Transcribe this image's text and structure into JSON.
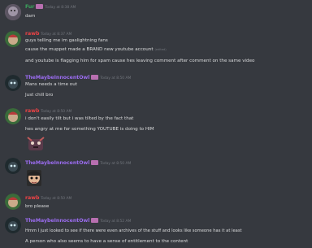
{
  "colors": {
    "background": "#36393f",
    "text": "#dcddde",
    "timestamp": "#72767d",
    "user_fur": "#3ba55d",
    "user_rawb": "#ed4245",
    "user_owl": "#9b6cf0",
    "badge": "#b86fb0"
  },
  "messages": [
    {
      "user": "Fur",
      "timestamp": "Today at 8:38 AM",
      "lines": [
        "dam"
      ]
    },
    {
      "user": "rawb",
      "timestamp": "Today at 8:37 AM",
      "lines": [
        "guys telling me im gaslightning fans",
        "cause the muppet made a BRAND new youtube account",
        "and youtube is flagging him for spam cause hes leaving comment after comment on the same video"
      ],
      "edited_label": "(edited)"
    },
    {
      "user": "TheMaybeInnocentOwl",
      "timestamp": "Today at 8:50 AM",
      "lines": [
        "Mans needs a time out",
        "Just chill bro"
      ]
    },
    {
      "user": "rawb",
      "timestamp": "Today at 8:50 AM",
      "lines": [
        "i don't easily tilt but i was tilted by the fact that",
        "hes angry at me for something YOUTUBE is doing to HIM"
      ],
      "has_sticker": true
    },
    {
      "user": "TheMaybeInnocentOwl",
      "timestamp": "Today at 8:50 AM",
      "lines": [],
      "has_sticker": true
    },
    {
      "user": "rawb",
      "timestamp": "Today at 8:50 AM",
      "lines": [
        "bro please"
      ]
    },
    {
      "user": "TheMaybeInnocentOwl",
      "timestamp": "Today at 8:52 AM",
      "lines": [
        "Hmm I just looked to see if there were even archives of the stuff and looks like someone has it at least",
        "A person who also seems to have a sense of entitlement to the content"
      ]
    }
  ]
}
